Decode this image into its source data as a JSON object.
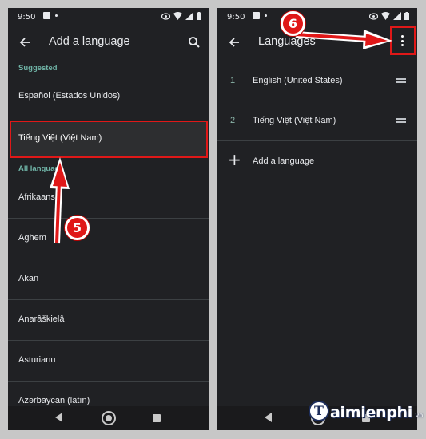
{
  "colors": {
    "background": "#202124",
    "accent": "#6fb3a6",
    "highlight_border": "#e01818"
  },
  "status_bar": {
    "time": "9:50"
  },
  "left_screen": {
    "title": "Add a language",
    "suggested_header": "Suggested",
    "suggested_items": [
      {
        "label": "Español (Estados Unidos)"
      },
      {
        "label": "Tiếng Việt (Việt Nam)",
        "selected": true
      }
    ],
    "all_header": "All languag",
    "all_items": [
      {
        "label": "Afrikaans"
      },
      {
        "label": "Aghem"
      },
      {
        "label": "Akan"
      },
      {
        "label": "Anarâškielâ"
      },
      {
        "label": "Asturianu"
      },
      {
        "label": "Azərbaycan (latın)"
      }
    ]
  },
  "right_screen": {
    "title": "Languages",
    "languages": [
      {
        "num": "1",
        "label": "English (United States)"
      },
      {
        "num": "2",
        "label": "Tiếng Việt (Việt Nam)"
      }
    ],
    "add_label": "Add a language"
  },
  "annotations": {
    "step_left": "5",
    "step_right": "6"
  },
  "watermark": {
    "letter": "T",
    "text": "aimienphi",
    "suffix": ".vn"
  }
}
